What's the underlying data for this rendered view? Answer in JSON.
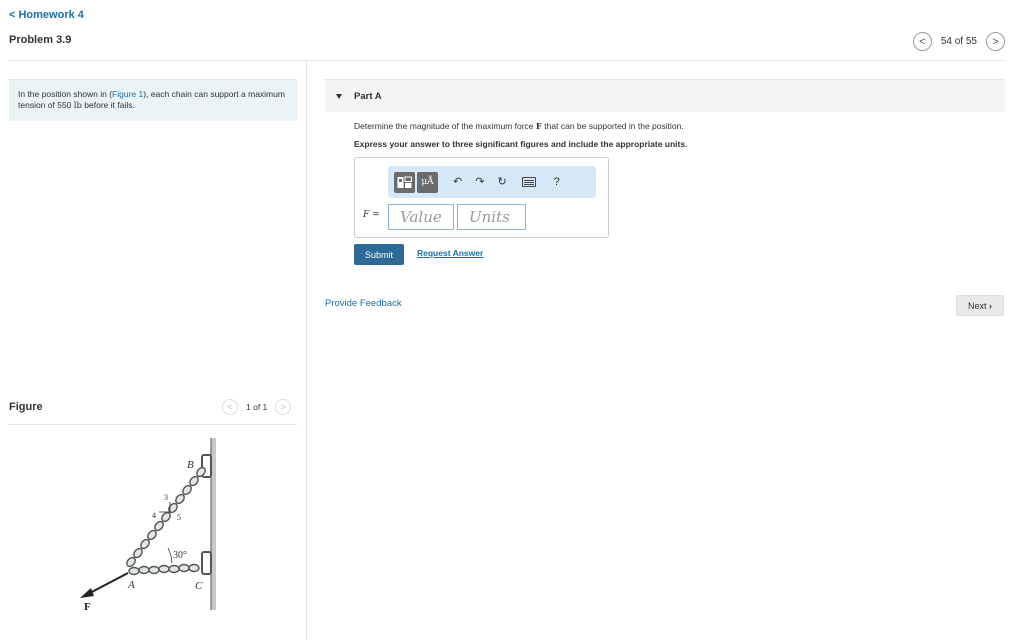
{
  "nav": {
    "back_label": "< Homework 4",
    "problem_title": "Problem 3.9",
    "pager_text": "54 of 55",
    "prev_glyph": "<",
    "next_glyph": ">"
  },
  "problem": {
    "text_before_link": "In the position shown in (",
    "figure_link": "Figure 1",
    "text_mid": "), each chain can support a maximum tension of 550 ",
    "unit": "lb",
    "text_after": " before it fails."
  },
  "figure": {
    "title": "Figure",
    "pager_text": "1 of 1",
    "labels": {
      "B": "B",
      "A": "A",
      "C": "C",
      "F": "F",
      "angle": "30°",
      "slope_3": "3",
      "slope_4": "4",
      "slope_5": "5"
    }
  },
  "part": {
    "title": "Part A",
    "question_before": "Determine the magnitude of the maximum force ",
    "question_symbol": "F",
    "question_after": " that can be supported in the position.",
    "instruction": "Express your answer to three significant figures and include the appropriate units."
  },
  "toolbar": {
    "mu_label": "μÅ",
    "undo_icon": "undo-icon",
    "redo_icon": "redo-icon",
    "reset_icon": "reset-icon",
    "keyboard_icon": "keyboard-icon",
    "help_label": "?"
  },
  "answer": {
    "var_label": "F",
    "equals": " =",
    "value_placeholder": "Value",
    "units_placeholder": "Units"
  },
  "actions": {
    "submit_label": "Submit",
    "request_label": "Request Answer",
    "feedback_label": "Provide Feedback",
    "next_label": "Next"
  }
}
